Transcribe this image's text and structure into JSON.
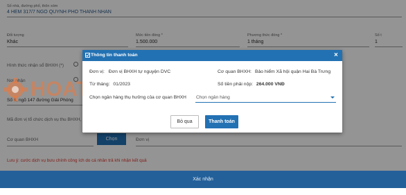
{
  "form": {
    "address_label": "Số nhà, đường phố, thôn xóm",
    "address_value": "4 HEM 317/7 NGO QUYNH PHO THANH NHAN",
    "subject_label": "Đối tượng",
    "subject_value": "Khác",
    "base_amount_label": "Mức tiền đóng *",
    "base_amount_value": "1.500.000",
    "method_label": "Phương thức đóng *",
    "method_value": "1 tháng",
    "months_label": "Số t",
    "months_value": "1",
    "receive_method_label": "Hình thức nhận sổ BHXH (*)",
    "receive_place_label": "Nơi nhận",
    "receive_address_value": "Số 6, ngõ 147 đường Giải Phóng",
    "service_unit_label": "Mã đơn vị tổ chức dịch vụ thu BHXH, B",
    "agency_label": "Cơ quan BHXH",
    "choose_button": "Chọn",
    "unit_placeholder": "Đơn vị",
    "note": "Lưu ý: cước dịch vụ bưu chính công ích do cá nhân trả khi nhận kết quả",
    "confirm_button": "Xác nhận"
  },
  "modal": {
    "title": "Thông tin thanh toán",
    "close_glyph": "×",
    "unit_label": "Đơn vị:",
    "unit_value": "Đơn vị BHXH tự nguyện DVC",
    "agency_label": "Cơ quan BHXH:",
    "agency_value": "Bảo hiểm Xã hội quận Hai Bà Trưng",
    "from_month_label": "Từ tháng:",
    "from_month_value": "01/2023",
    "amount_label": "Số tiền phải nộp:",
    "amount_value": "264.000 VNĐ",
    "bank_label": "Chọn ngân hàng thụ hưởng của cơ quan BHXH",
    "bank_placeholder": "Chọn ngân hàng",
    "skip_button": "Bỏ qua",
    "pay_button": "Thanh toán"
  },
  "watermark": {
    "text": "HOATIEU.vn"
  },
  "colors": {
    "primary": "#2271b3",
    "note_red": "#d9342b",
    "confirm_bar": "#23609a",
    "watermark": "#eb783c"
  },
  "icons": {
    "checkbox": "checkbox-icon",
    "close": "close-icon",
    "dropdown": "chevron-down-icon",
    "radio": "radio-icon",
    "logo": "gear-logo-icon"
  }
}
